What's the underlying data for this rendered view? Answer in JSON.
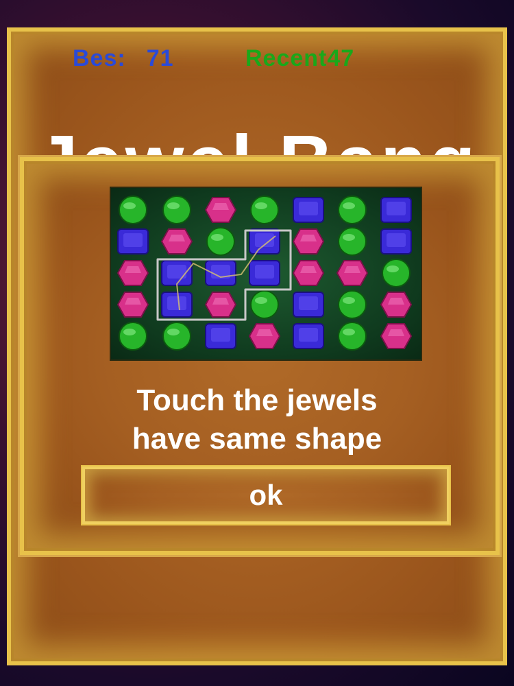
{
  "scores": {
    "best_label": "Bes:",
    "best_value": "71",
    "recent_label": "Recent",
    "recent_value": "47"
  },
  "background_title": "Jewel Bang",
  "tutorial": {
    "instruction_line1": "Touch the jewels",
    "instruction_line2": "have same shape",
    "ok_label": "ok"
  },
  "board": {
    "rows": [
      [
        "green",
        "green",
        "pink",
        "green",
        "blue",
        "green",
        "blue"
      ],
      [
        "blue",
        "pink",
        "green",
        "blue",
        "pink",
        "green",
        "blue"
      ],
      [
        "pink",
        "blue",
        "blue",
        "blue",
        "pink",
        "pink",
        "green"
      ],
      [
        "pink",
        "blue",
        "pink",
        "green",
        "blue",
        "green",
        "pink"
      ],
      [
        "green",
        "green",
        "blue",
        "pink",
        "blue",
        "green",
        "pink"
      ]
    ],
    "highlighted": [
      [
        1,
        3
      ],
      [
        2,
        1
      ],
      [
        2,
        2
      ],
      [
        2,
        3
      ],
      [
        3,
        1
      ]
    ]
  },
  "colors": {
    "best": "#2a4ad8",
    "recent": "#1aa81a",
    "green_jewel": "#27b52a",
    "blue_jewel": "#3a2ad8",
    "pink_jewel": "#d8308a"
  }
}
